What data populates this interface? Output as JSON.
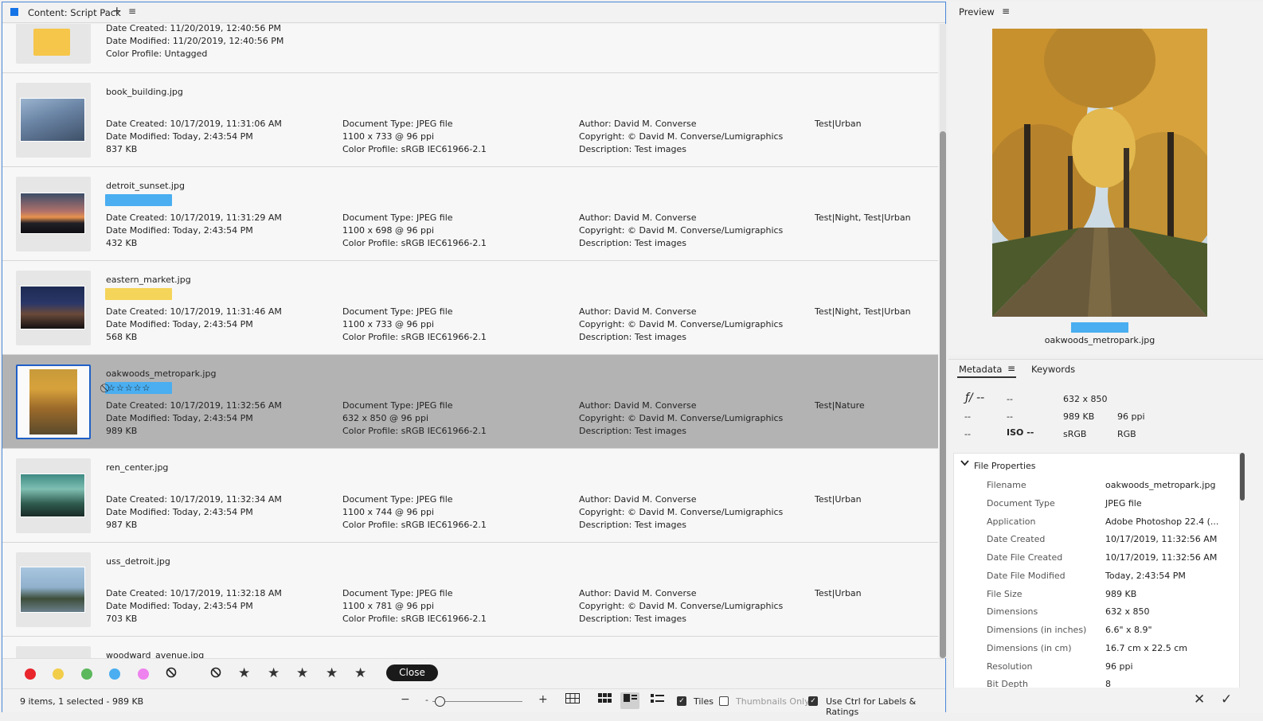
{
  "content": {
    "title": "Content: Script Pack",
    "plus": "+",
    "menu": "≡",
    "partial_row": {
      "lines": [
        "Date Created: 11/20/2019, 12:40:56 PM",
        "Date Modified: 11/20/2019, 12:40:56 PM",
        "Color Profile: Untagged"
      ]
    },
    "rows": [
      {
        "name": "book_building.jpg",
        "label_color": "",
        "created": "Date Created: 10/17/2019, 11:31:06 AM",
        "modified": "Date Modified: Today, 2:43:54 PM",
        "size": "837 KB",
        "doctype": "Document Type: JPEG file",
        "dims": "1100 x 733 @ 96 ppi",
        "profile": "Color Profile: sRGB IEC61966-2.1",
        "author": "Author: David M. Converse",
        "copyright": "Copyright: © David M. Converse/Lumigraphics",
        "desc": "Description: Test images",
        "keywords": "Test|Urban"
      },
      {
        "name": "detroit_sunset.jpg",
        "label_color": "#4aaef0",
        "created": "Date Created: 10/17/2019, 11:31:29 AM",
        "modified": "Date Modified: Today, 2:43:54 PM",
        "size": "432 KB",
        "doctype": "Document Type: JPEG file",
        "dims": "1100 x 698 @ 96 ppi",
        "profile": "Color Profile: sRGB IEC61966-2.1",
        "author": "Author: David M. Converse",
        "copyright": "Copyright: © David M. Converse/Lumigraphics",
        "desc": "Description: Test images",
        "keywords": "Test|Night, Test|Urban"
      },
      {
        "name": "eastern_market.jpg",
        "label_color": "#f5d45a",
        "created": "Date Created: 10/17/2019, 11:31:46 AM",
        "modified": "Date Modified: Today, 2:43:54 PM",
        "size": "568 KB",
        "doctype": "Document Type: JPEG file",
        "dims": "1100 x 733 @ 96 ppi",
        "profile": "Color Profile: sRGB IEC61966-2.1",
        "author": "Author: David M. Converse",
        "copyright": "Copyright: © David M. Converse/Lumigraphics",
        "desc": "Description: Test images",
        "keywords": "Test|Night, Test|Urban"
      },
      {
        "name": "oakwoods_metropark.jpg",
        "label_color": "",
        "stars": "⃠☆☆☆☆☆",
        "created": "Date Created: 10/17/2019, 11:32:56 AM",
        "modified": "Date Modified: Today, 2:43:54 PM",
        "size": "989 KB",
        "doctype": "Document Type: JPEG file",
        "dims": "632 x 850 @ 96 ppi",
        "profile": "Color Profile: sRGB IEC61966-2.1",
        "author": "Author: David M. Converse",
        "copyright": "Copyright: © David M. Converse/Lumigraphics",
        "desc": "Description: Test images",
        "keywords": "Test|Nature"
      },
      {
        "name": "ren_center.jpg",
        "label_color": "",
        "created": "Date Created: 10/17/2019, 11:32:34 AM",
        "modified": "Date Modified: Today, 2:43:54 PM",
        "size": "987 KB",
        "doctype": "Document Type: JPEG file",
        "dims": "1100 x 744 @ 96 ppi",
        "profile": "Color Profile: sRGB IEC61966-2.1",
        "author": "Author: David M. Converse",
        "copyright": "Copyright: © David M. Converse/Lumigraphics",
        "desc": "Description: Test images",
        "keywords": "Test|Urban"
      },
      {
        "name": "uss_detroit.jpg",
        "label_color": "",
        "created": "Date Created: 10/17/2019, 11:32:18 AM",
        "modified": "Date Modified: Today, 2:43:54 PM",
        "size": "703 KB",
        "doctype": "Document Type: JPEG file",
        "dims": "1100 x 781 @ 96 ppi",
        "profile": "Color Profile: sRGB IEC61966-2.1",
        "author": "Author: David M. Converse",
        "copyright": "Copyright: © David M. Converse/Lumigraphics",
        "desc": "Description: Test images",
        "keywords": "Test|Urban"
      }
    ],
    "partial_last_name": "woodward_avenue.jpg"
  },
  "filter": {
    "label_colors": [
      "#e8262c",
      "#f2cd4a",
      "#5cb85c",
      "#4aaef0",
      "#ee82ee"
    ],
    "no_label": "⃠",
    "no_rating": "⃠",
    "star": "★",
    "close_label": "Close"
  },
  "status": {
    "text": "9 items, 1 selected - 989 KB",
    "minus": "−",
    "plus": "+",
    "zoom_level": 0.05,
    "tiles_label": "Tiles",
    "thumbnails_only_label": "Thumbnails Only",
    "ctrl_label": "Use Ctrl for Labels & Ratings",
    "tiles_checked": true,
    "thumbnails_only_checked": false,
    "ctrl_checked": true
  },
  "preview": {
    "title": "Preview",
    "menu": "≡",
    "filename": "oakwoods_metropark.jpg",
    "label_color": "#4aaef0"
  },
  "metadata": {
    "tab": "Metadata",
    "menu": "≡",
    "keywords_tab": "Keywords",
    "quickview": {
      "aperture": "ƒ/ --",
      "shutter": "--",
      "dims": "632 x 850",
      "exposure": "--",
      "metering": "--",
      "size": "989 KB",
      "ppi": "96 ppi",
      "wb": "--",
      "iso": "ISO --",
      "colorspace": "sRGB",
      "mode": "RGB"
    },
    "section": "File Properties",
    "properties": [
      {
        "k": "Filename",
        "v": "oakwoods_metropark.jpg"
      },
      {
        "k": "Document Type",
        "v": "JPEG file"
      },
      {
        "k": "Application",
        "v": "Adobe Photoshop 22.4 (..."
      },
      {
        "k": "Date Created",
        "v": "10/17/2019, 11:32:56 AM"
      },
      {
        "k": "Date File Created",
        "v": "10/17/2019, 11:32:56 AM"
      },
      {
        "k": "Date File Modified",
        "v": "Today, 2:43:54 PM"
      },
      {
        "k": "File Size",
        "v": "989 KB"
      },
      {
        "k": "Dimensions",
        "v": "632 x 850"
      },
      {
        "k": "Dimensions (in inches)",
        "v": "6.6\" x 8.9\""
      },
      {
        "k": "Dimensions (in cm)",
        "v": "16.7 cm x 22.5 cm"
      },
      {
        "k": "Resolution",
        "v": "96 ppi"
      },
      {
        "k": "Bit Depth",
        "v": "8"
      }
    ]
  },
  "bottom": {
    "cancel": "✕",
    "ok": "✓"
  }
}
